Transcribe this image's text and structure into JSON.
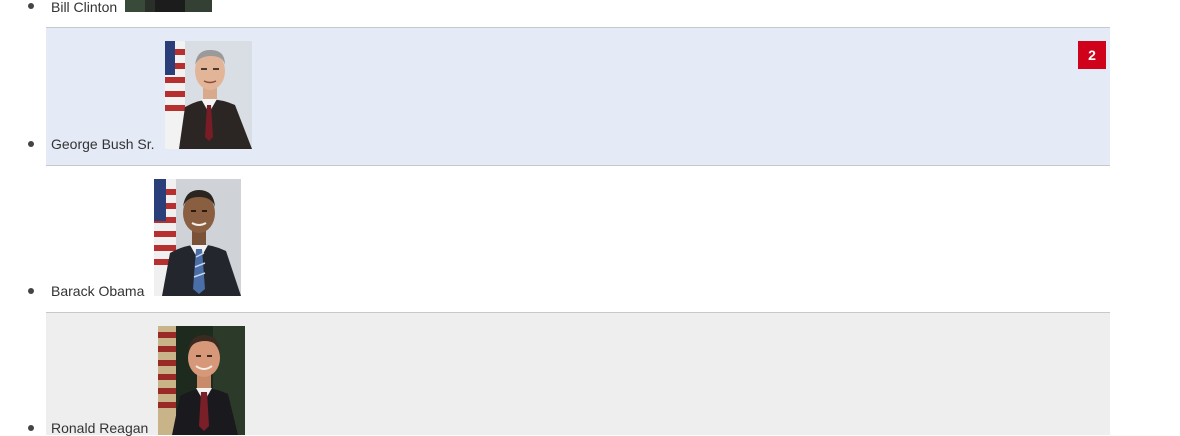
{
  "presidents": [
    {
      "name": "Bill Clinton"
    },
    {
      "name": "George Bush Sr.",
      "badge": "2"
    },
    {
      "name": "Barack Obama"
    },
    {
      "name": "Ronald Reagan"
    }
  ],
  "colors": {
    "highlight_row": "#e4eaf6",
    "alt_row": "#eeeeee",
    "badge": "#d0021b",
    "divider": "#c8c8c8"
  },
  "icons": {
    "portrait": "president-portrait-image",
    "bullet": "list-bullet"
  }
}
